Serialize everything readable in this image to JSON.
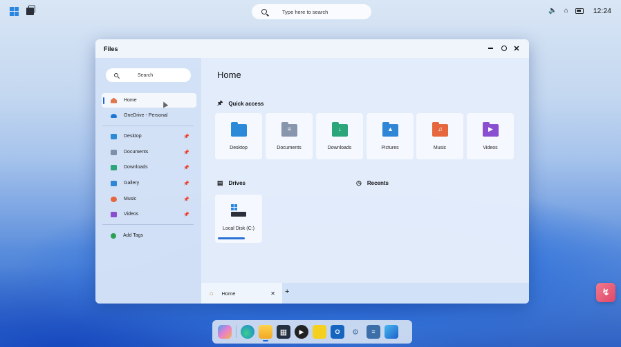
{
  "topbar": {
    "search_placeholder": "Type here to search",
    "clock": "12:24",
    "icons": [
      "start-icon",
      "task-view-icon",
      "volume-icon",
      "wifi-icon",
      "battery-icon"
    ]
  },
  "window": {
    "title": "Files",
    "sidebar": {
      "search_label": "Search",
      "items": [
        {
          "label": "Home",
          "icon": "home-icon",
          "color": "#e2774a"
        },
        {
          "label": "OneDrive - Personal",
          "icon": "cloud-icon",
          "color": "#1c78d4"
        },
        {
          "label": "Desktop",
          "icon": "desktop-folder-icon",
          "color": "#2a8ad8",
          "pinned": true
        },
        {
          "label": "Documents",
          "icon": "documents-folder-icon",
          "color": "#7f8fa8",
          "pinned": true
        },
        {
          "label": "Downloads",
          "icon": "downloads-folder-icon",
          "color": "#2ba57a",
          "pinned": true
        },
        {
          "label": "Gallery",
          "icon": "gallery-icon",
          "color": "#2f86d6",
          "pinned": true
        },
        {
          "label": "Music",
          "icon": "music-folder-icon",
          "color": "#e6663e",
          "pinned": true
        },
        {
          "label": "Videos",
          "icon": "videos-folder-icon",
          "color": "#8a4fd0",
          "pinned": true
        },
        {
          "label": "Add Tags",
          "icon": "add-tags-icon",
          "color": "#2ba057"
        }
      ]
    },
    "content": {
      "page_title": "Home",
      "quick_access_heading": "Quick access",
      "quick_access": [
        {
          "label": "Desktop",
          "color": "#2a8ad8"
        },
        {
          "label": "Documents",
          "color": "#8896ad"
        },
        {
          "label": "Downloads",
          "color": "#2ba57a"
        },
        {
          "label": "Pictures",
          "color": "#2f86d6"
        },
        {
          "label": "Music",
          "color": "#e6663e"
        },
        {
          "label": "Videos",
          "color": "#8a4fd0"
        }
      ],
      "drives_heading": "Drives",
      "recents_heading": "Recents",
      "drives": [
        {
          "label": "Local Disk (C:)",
          "usage_fraction": 0.65
        }
      ]
    },
    "tabs": [
      {
        "label": "Home"
      }
    ]
  },
  "taskbar": {
    "apps": [
      "copilot-app-icon",
      "edge-icon",
      "file-explorer-icon",
      "store-icon",
      "media-player-icon",
      "sticky-notes-icon",
      "outlook-icon",
      "settings-icon",
      "notepad-icon",
      "photos-icon"
    ],
    "active": "file-explorer-icon"
  }
}
